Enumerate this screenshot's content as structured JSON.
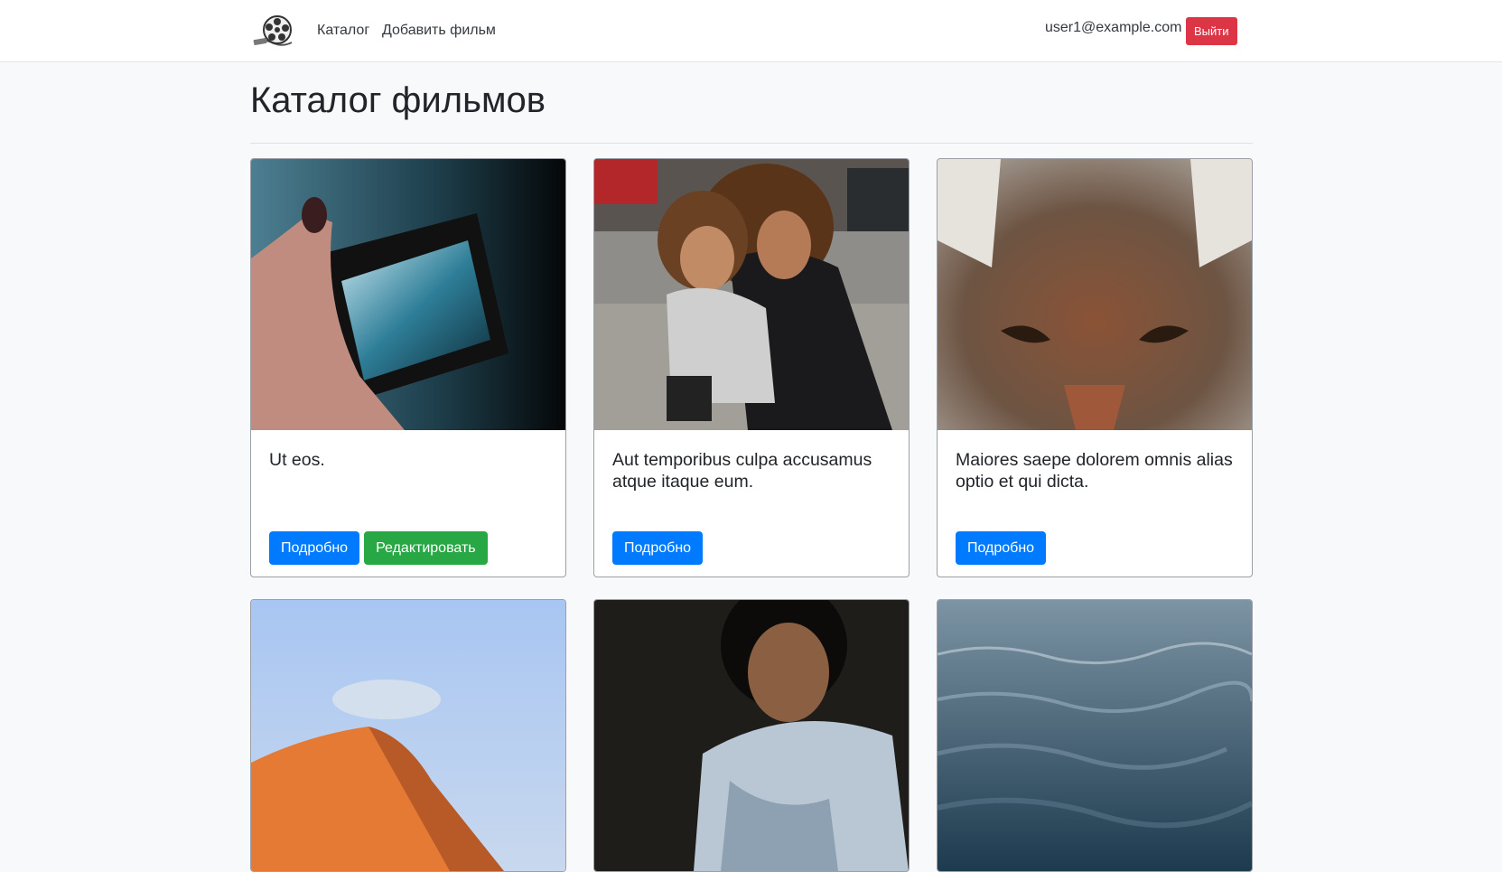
{
  "navbar": {
    "logo_icon": "film-reel-icon",
    "links": [
      {
        "label": "Каталог"
      },
      {
        "label": "Добавить фильм"
      }
    ],
    "user_email": "user1@example.com",
    "logout_label": "Выйти"
  },
  "page": {
    "title": "Каталог фильмов"
  },
  "movies": [
    {
      "title": "Ut eos.",
      "image": "phone-city-photo",
      "details_label": "Подробно",
      "edit_label": "Редактировать"
    },
    {
      "title": "Aut temporibus culpa accusamus atque itaque eum.",
      "image": "mother-child-photo",
      "details_label": "Подробно"
    },
    {
      "title": "Maiores saepe dolorem omnis alias optio et qui dicta.",
      "image": "coyote-photo",
      "details_label": "Подробно"
    },
    {
      "title": "",
      "image": "sand-dune-photo"
    },
    {
      "title": "",
      "image": "woman-reading-photo"
    },
    {
      "title": "",
      "image": "ocean-water-photo"
    }
  ],
  "colors": {
    "primary": "#007bff",
    "success": "#28a745",
    "danger": "#dc3545"
  }
}
